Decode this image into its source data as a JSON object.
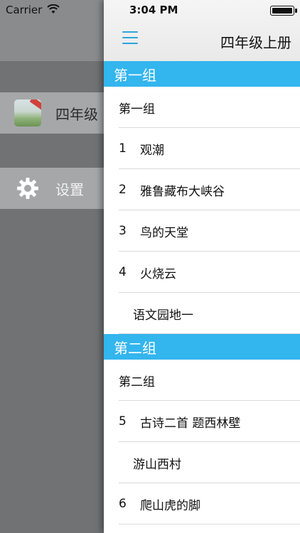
{
  "status_bar": {
    "carrier": "Carrier",
    "time": "3:04 PM"
  },
  "drawer": {
    "book_label": "四年级",
    "settings_label": "设置"
  },
  "header": {
    "title": "四年级上册"
  },
  "colors": {
    "accent": "#33b5ee",
    "menu_icon": "#2aa6dd"
  },
  "sections": [
    {
      "title": "第一组",
      "rows": [
        {
          "num": "",
          "text": "第一组"
        },
        {
          "num": "1",
          "text": "观潮"
        },
        {
          "num": "2",
          "text": "雅鲁藏布大峡谷"
        },
        {
          "num": "3",
          "text": "鸟的天堂"
        },
        {
          "num": "4",
          "text": "火烧云"
        },
        {
          "num": "",
          "text": "语文园地一"
        }
      ]
    },
    {
      "title": "第二组",
      "rows": [
        {
          "num": "",
          "text": "第二组"
        },
        {
          "num": "5",
          "text": "古诗二首 题西林壁"
        },
        {
          "num": "",
          "text": "游山西村"
        },
        {
          "num": "6",
          "text": "爬山虎的脚"
        }
      ]
    }
  ]
}
